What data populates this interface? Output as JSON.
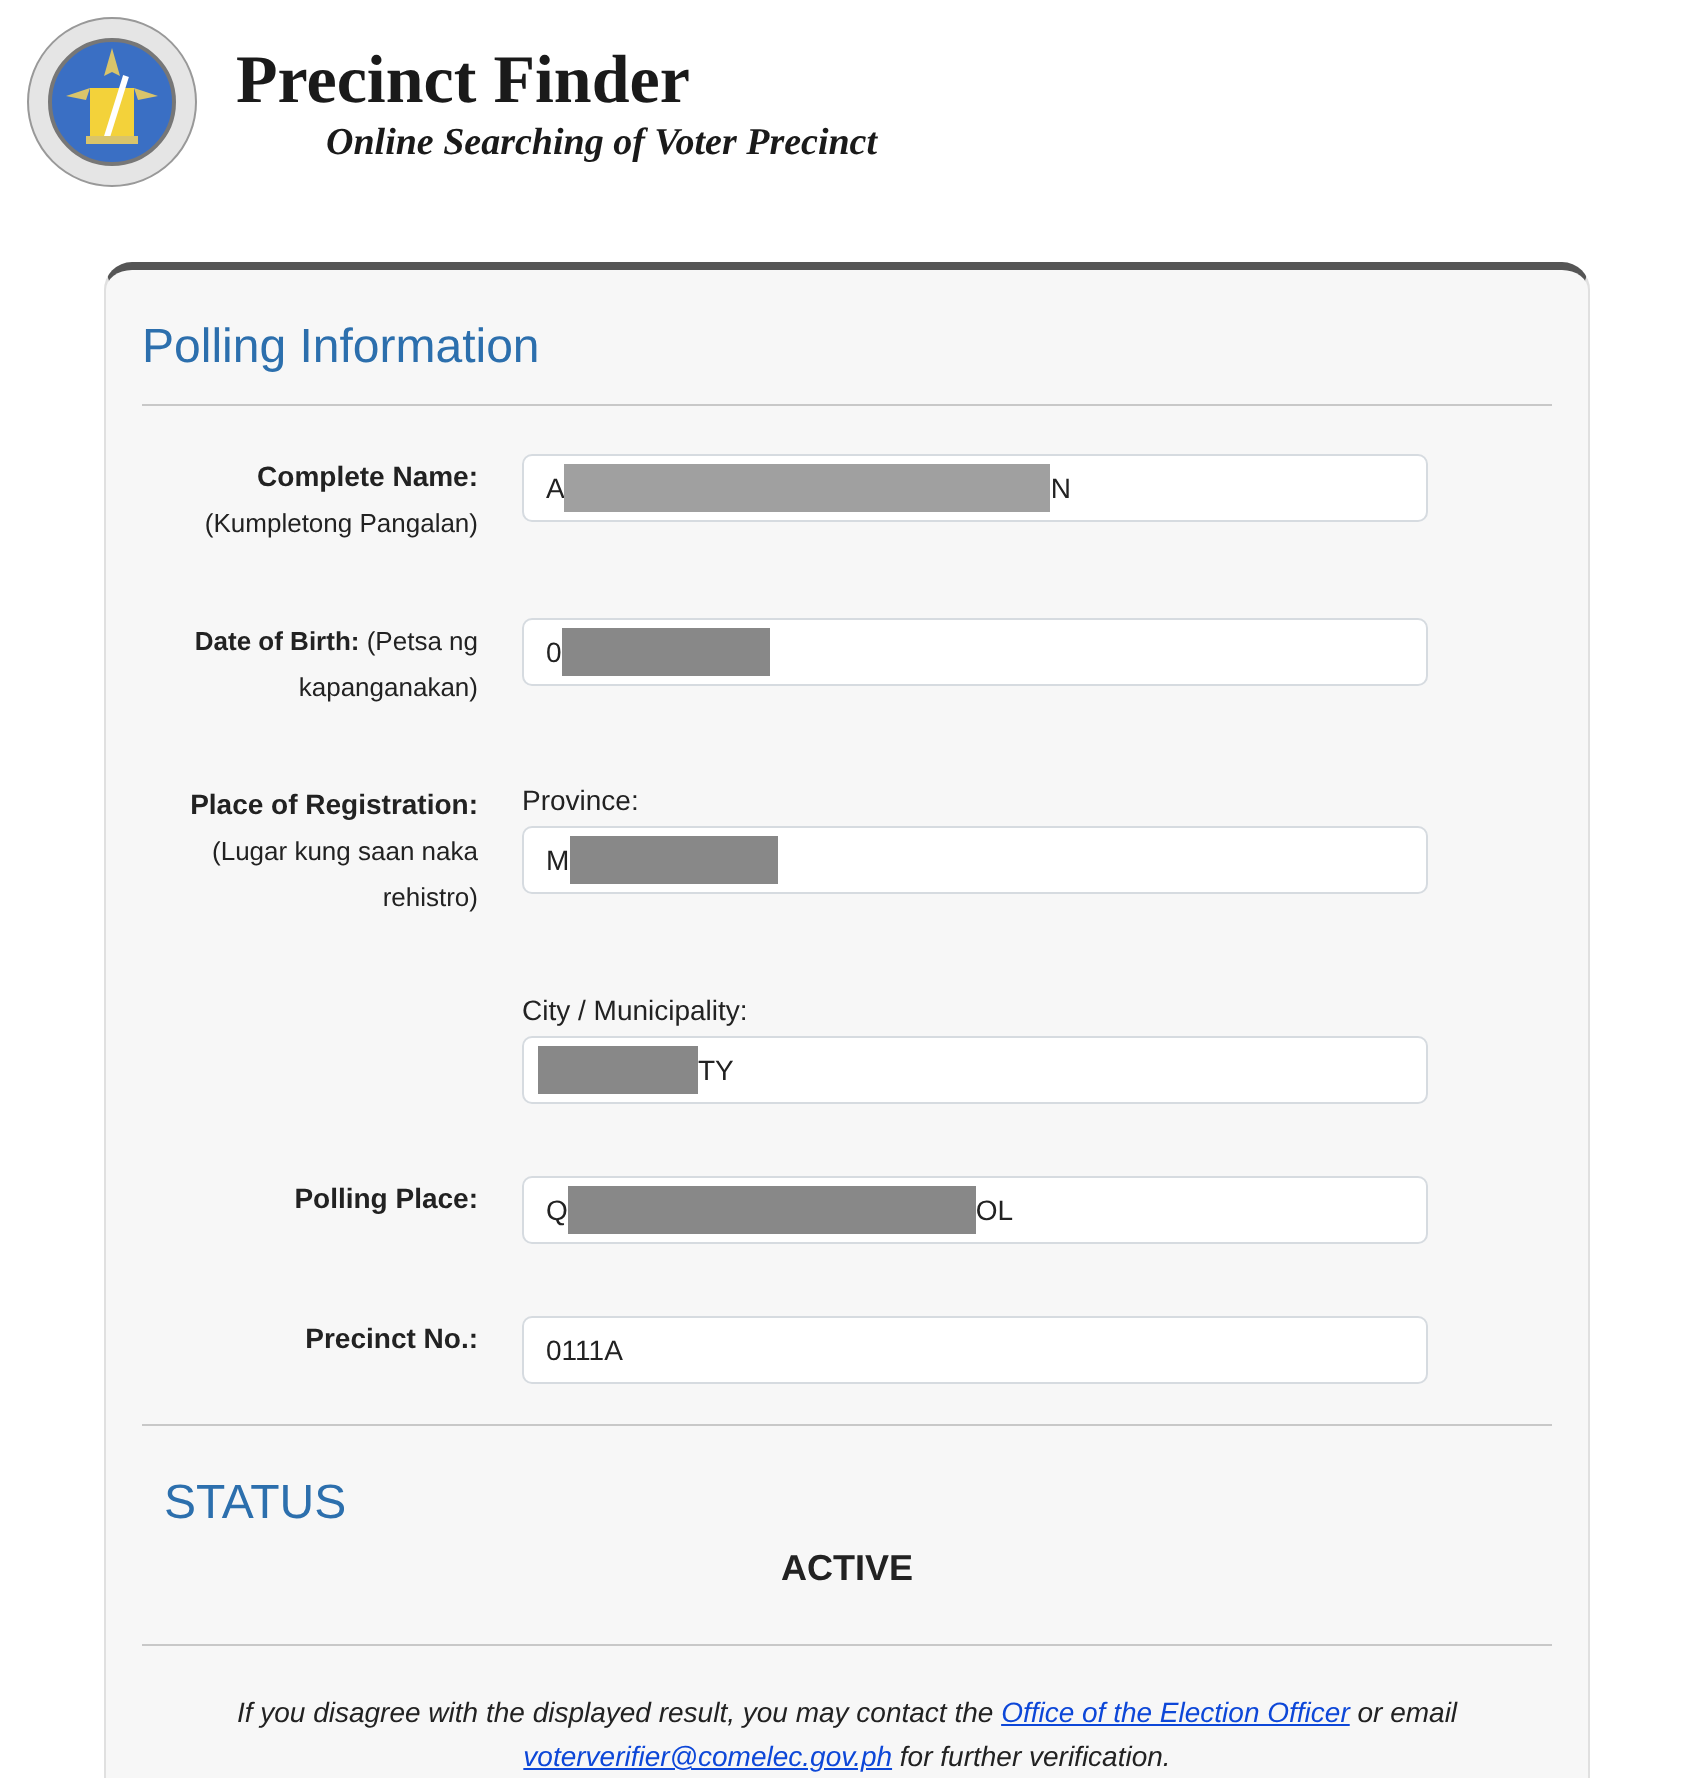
{
  "header": {
    "title": "Precinct Finder",
    "subtitle": "Online Searching of Voter Precinct"
  },
  "card": {
    "heading": "Polling Information",
    "fields": [
      {
        "kind": "stacked",
        "label": "Complete Name:",
        "sublabel": "(Kumpletong Pangalan)",
        "value_start": "A",
        "value_end": "N"
      },
      {
        "kind": "inline",
        "label": "**Date of Birth:** (Petsa ng kapanganakan)",
        "value_start": "0"
      },
      {
        "kind": "stacked",
        "label": "Place of Registration:",
        "sublabel": "(Lugar kung saan naka rehistro)",
        "caption": "Province:",
        "value_start": "M"
      },
      {
        "kind": "stacked",
        "caption": "City / Municipality:",
        "value_end": "TY"
      },
      {
        "kind": "stacked",
        "label": "Polling Place:",
        "value_start": "Q",
        "value_end": "OL"
      },
      {
        "kind": "stacked",
        "label": "Precinct No.:",
        "value_start": "0111A"
      }
    ],
    "status_heading": "STATUS",
    "status": "ACTIVE",
    "note": {
      "before": "If you disagree with the displayed result, you may contact the",
      "link": "Office of the Election Officer",
      "middle": "or email",
      "email": "voterverifier@comelec.gov.ph",
      "after": "for further verification."
    }
  }
}
